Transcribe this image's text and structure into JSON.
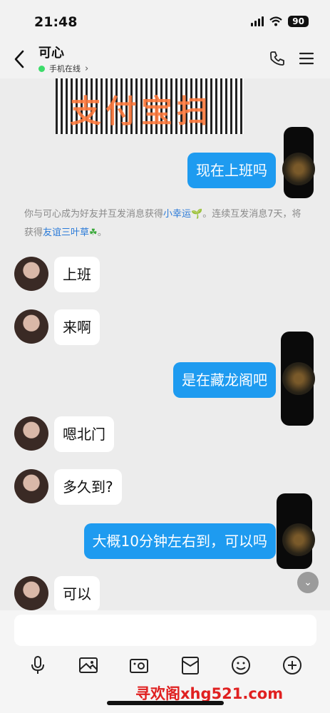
{
  "status_bar": {
    "time": "21:48",
    "battery": "90"
  },
  "header": {
    "name": "可心",
    "status": "手机在线"
  },
  "qr_overlay_text": "支付宝扫",
  "system_message": {
    "part1": "你与可心成为好友并互发消息获得",
    "link1": "小幸运",
    "part2": "。连续互发消息7天，将获得",
    "link2": "友谊三叶草",
    "part3": "。"
  },
  "messages": [
    {
      "direction": "out",
      "text": "现在上班吗"
    },
    {
      "direction": "in",
      "text": "上班"
    },
    {
      "direction": "in",
      "text": "来啊"
    },
    {
      "direction": "out",
      "text": "是在藏龙阁吧"
    },
    {
      "direction": "in",
      "text": "嗯北门"
    },
    {
      "direction": "in",
      "text": "多久到?"
    },
    {
      "direction": "out",
      "text": "大概10分钟左右到，可以吗"
    },
    {
      "direction": "in",
      "text": "可以"
    }
  ],
  "watermark": "寻欢阁xhg521.com",
  "colors": {
    "outgoing_bubble": "#1e9bf0",
    "incoming_bubble": "#ffffff",
    "link": "#2a7ad8",
    "watermark": "#e02020"
  }
}
